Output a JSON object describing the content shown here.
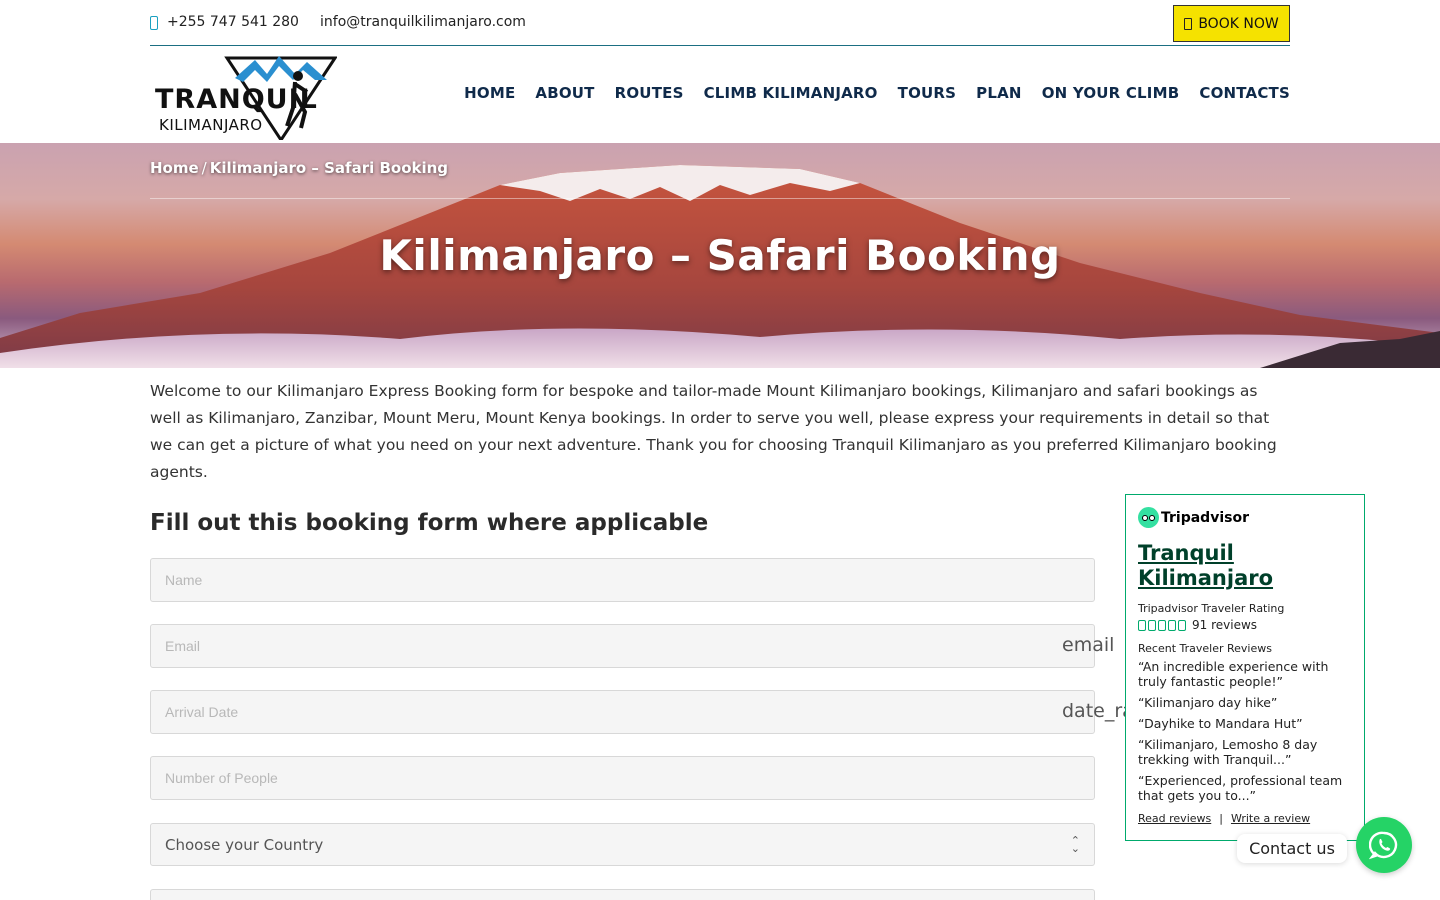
{
  "topbar": {
    "phone": "+255 747 541 280",
    "email": "info@tranquilkilimanjaro.com",
    "book_label": "BOOK NOW"
  },
  "header": {
    "logo_main": "TRANQUIL",
    "logo_sub": "KILIMANJARO",
    "nav": [
      "HOME",
      "ABOUT",
      "ROUTES",
      "CLIMB KILIMANJARO",
      "TOURS",
      "PLAN",
      "ON YOUR CLIMB",
      "CONTACTS"
    ]
  },
  "hero": {
    "breadcrumb_home": "Home",
    "breadcrumb_sep": "/",
    "breadcrumb_current": "Kilimanjaro – Safari Booking",
    "title": "Kilimanjaro – Safari Booking"
  },
  "intro": "Welcome to our Kilimanjaro Express Booking form for bespoke and tailor-made Mount Kilimanjaro bookings, Kilimanjaro and safari bookings as well as Kilimanjaro, Zanzibar, Mount Meru, Mount Kenya bookings. In order to serve you well, please express your requirements in detail so that we can get a picture of what you need on your next adventure. Thank you for choosing Tranquil Kilimanjaro as you preferred Kilimanjaro booking agents.",
  "form": {
    "title": "Fill out this booking form where applicable",
    "name_placeholder": "Name",
    "email_placeholder": "Email",
    "email_ghost": "email",
    "arrival_placeholder": "Arrival Date",
    "arrival_ghost": "date_ra",
    "people_placeholder": "Number of People",
    "country_value": "Choose your Country"
  },
  "tripadvisor": {
    "brand": "Tripadvisor",
    "business": "Tranquil Kilimanjaro",
    "rating_label": "Tripadvisor Traveler Rating",
    "reviews_count": "91 reviews",
    "rating_bubbles": 5,
    "recent_label": "Recent Traveler Reviews",
    "reviews": [
      "“An incredible experience with truly fantastic people!”",
      "“Kilimanjaro day hike”",
      "“Dayhike to Mandara Hut”",
      "“Kilimanjaro, Lemosho 8 day trekking with Tranquil...”",
      "“Experienced, professional team that gets you to...”"
    ],
    "read_reviews": "Read reviews",
    "link_sep": "|",
    "write_review": "Write a review"
  },
  "chat": {
    "label": "Contact us"
  },
  "colors": {
    "nav_text": "#0f2a4a",
    "book_button": "#f5e200",
    "tripadvisor_green": "#00aa6c",
    "whatsapp_green": "#25d366"
  }
}
